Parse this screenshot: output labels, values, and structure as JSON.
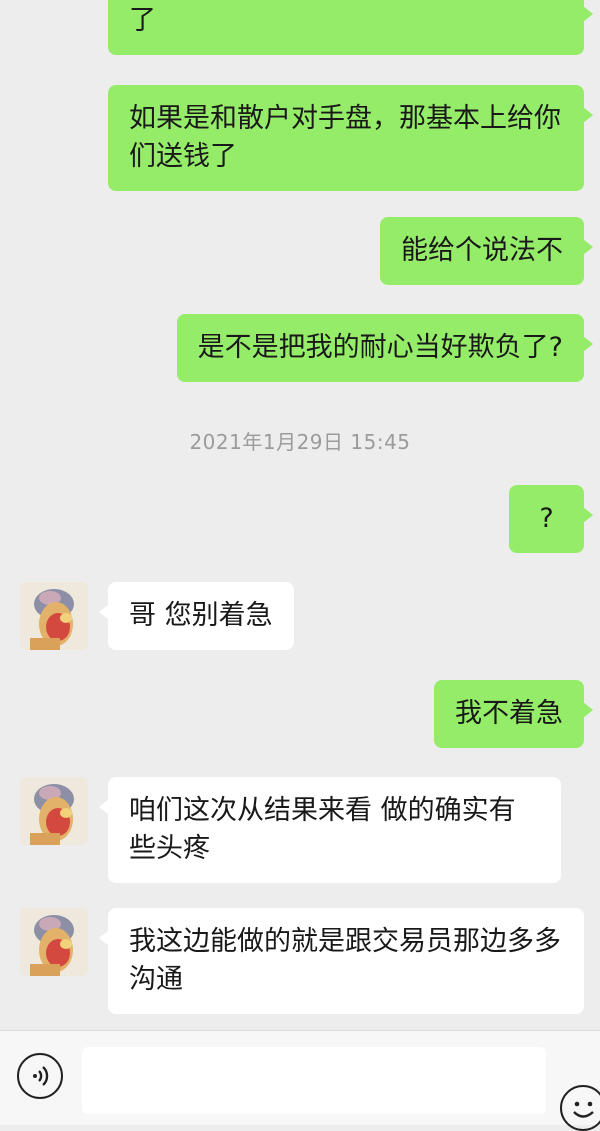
{
  "messages": [
    {
      "side": "sent",
      "text": "了"
    },
    {
      "side": "sent",
      "text": "如果是和散户对手盘，那基本上给你们送钱了"
    },
    {
      "side": "sent",
      "text": "能给个说法不"
    },
    {
      "side": "sent",
      "text": "是不是把我的耐心当好欺负了?"
    },
    {
      "side": "sent",
      "text": "?"
    },
    {
      "side": "recv",
      "text": "哥 您别着急"
    },
    {
      "side": "sent",
      "text": "我不着急"
    },
    {
      "side": "recv",
      "text": "咱们这次从结果来看 做的确实有些头疼"
    },
    {
      "side": "recv",
      "text": "我这边能做的就是跟交易员那边多多沟通"
    }
  ],
  "timestamp": "2021年1月29日 15:45",
  "input": {
    "value": "",
    "placeholder": ""
  },
  "icons": {
    "voice": "voice-icon",
    "emoji": "emoji-icon",
    "avatar": "contact-avatar"
  },
  "colors": {
    "sent_bubble": "#95ec69",
    "recv_bubble": "#ffffff",
    "background": "#ededed"
  }
}
